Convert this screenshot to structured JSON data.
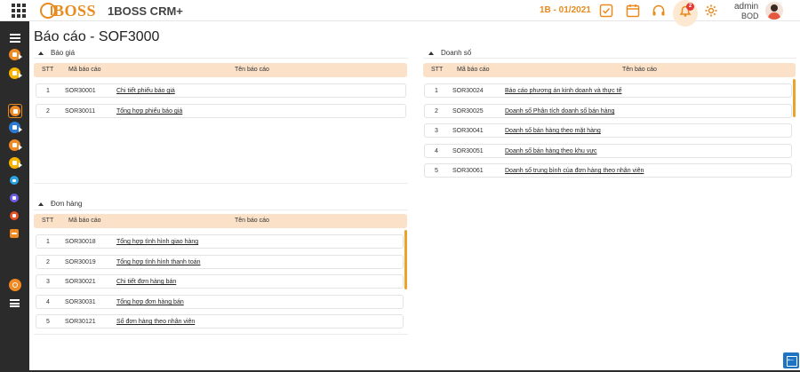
{
  "header": {
    "logo_text": "BOSS",
    "app_name": "1BOSS CRM+",
    "period": "1B - 01/2021",
    "notification_count": "2",
    "user_name": "admin",
    "user_role": "BOD",
    "accent_color": "#e98a1e"
  },
  "page": {
    "title": "Báo cáo - SOF3000"
  },
  "columns": {
    "stt": "STT",
    "code": "Mã báo cáo",
    "name": "Tên báo cáo"
  },
  "sections": {
    "bao_gia": {
      "title": "Báo giá",
      "rows": [
        {
          "stt": "1",
          "code": "SOR30001",
          "name": "Chi tiết phiếu báo giá"
        },
        {
          "stt": "2",
          "code": "SOR30011",
          "name": "Tổng hợp phiếu báo giá"
        }
      ]
    },
    "don_hang": {
      "title": "Đơn hàng",
      "rows": [
        {
          "stt": "1",
          "code": "SOR30018",
          "name": "Tổng hợp tình hình giao hàng"
        },
        {
          "stt": "2",
          "code": "SOR30019",
          "name": "Tổng hợp tình hình thanh toán"
        },
        {
          "stt": "3",
          "code": "SOR30021",
          "name": "Chi tiết đơn hàng bán"
        },
        {
          "stt": "4",
          "code": "SOR30031",
          "name": "Tổng hợp đơn hàng bán"
        },
        {
          "stt": "5",
          "code": "SOR30121",
          "name": "Số đơn hàng theo nhân viên"
        }
      ]
    },
    "doanh_so": {
      "title": "Doanh số",
      "rows": [
        {
          "stt": "1",
          "code": "SOR30024",
          "name": "Báo cáo phương án kinh doanh và thực tế"
        },
        {
          "stt": "2",
          "code": "SOR30025",
          "name": "Doanh số Phân tích doanh số bán hàng"
        },
        {
          "stt": "3",
          "code": "SOR30041",
          "name": "Doanh số bán hàng theo mặt hàng"
        },
        {
          "stt": "4",
          "code": "SOR30051",
          "name": "Doanh số bán hàng theo khu vực"
        },
        {
          "stt": "5",
          "code": "SOR30061",
          "name": "Doanh số trung bình của đơn hàng theo nhân viên"
        }
      ]
    }
  },
  "sidebar_icons": [
    {
      "name": "list-icon",
      "color": "#ffffff"
    },
    {
      "name": "module-icon-orange",
      "color": "#f08a24"
    },
    {
      "name": "module-icon-yellow",
      "color": "#f4b400"
    },
    {
      "name": "module-icon-active",
      "color": "#f08a24"
    },
    {
      "name": "module-icon-blue",
      "color": "#2d7bd4"
    },
    {
      "name": "module-icon-orange-2",
      "color": "#f08a24"
    },
    {
      "name": "module-icon-yellow-2",
      "color": "#f4b400"
    },
    {
      "name": "telegram-icon",
      "color": "#2aa3e0"
    },
    {
      "name": "module-icon-purple",
      "color": "#6c5ce7"
    },
    {
      "name": "module-icon-red",
      "color": "#e8502a"
    },
    {
      "name": "module-icon-orange-3",
      "color": "#f08a24"
    },
    {
      "name": "settings-icon",
      "color": "#f08a24"
    },
    {
      "name": "grid-list-icon",
      "color": "#ffffff"
    }
  ]
}
